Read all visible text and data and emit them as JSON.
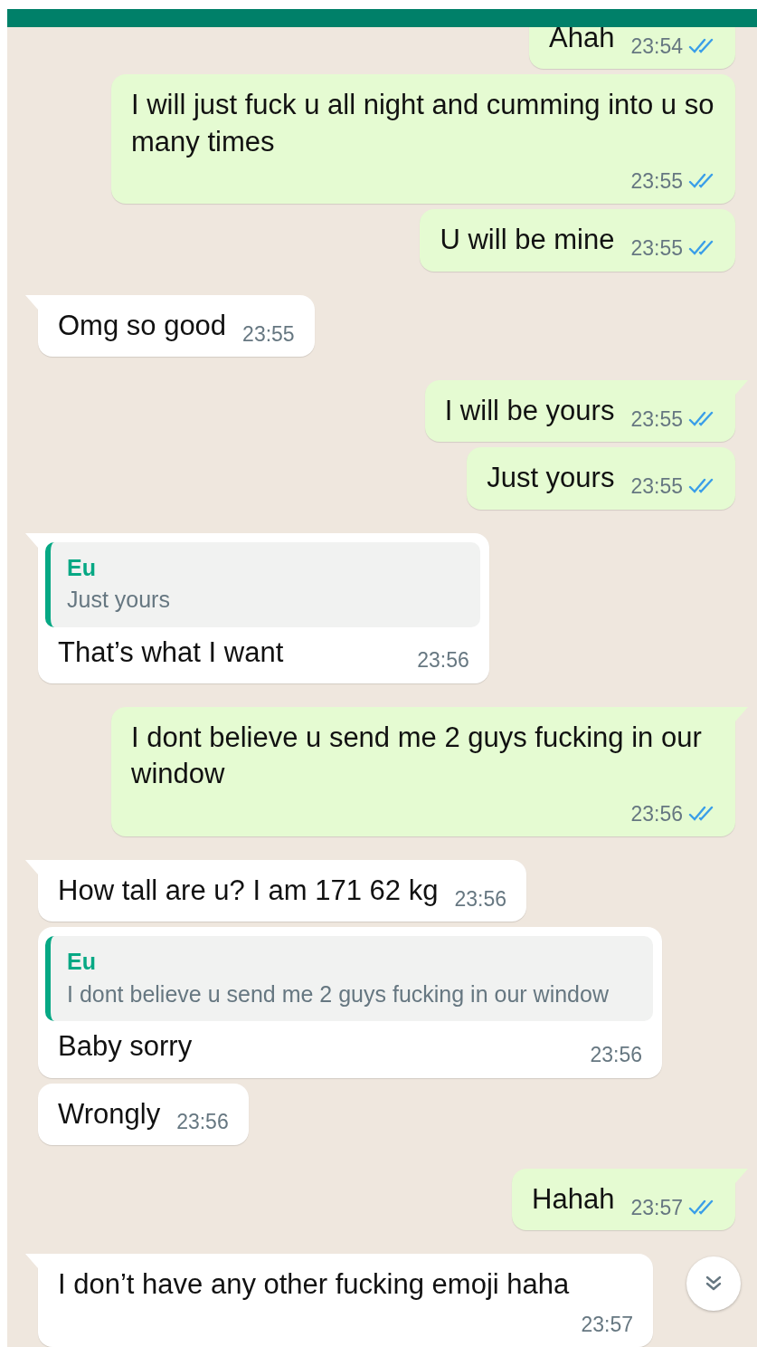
{
  "messages": [
    {
      "kind": "outgoing",
      "tail": false,
      "text": "Ahah",
      "time": "23:54",
      "read": true
    },
    {
      "kind": "outgoing",
      "tail": false,
      "text": "I will just fuck u all night and cumming into u so many times",
      "time": "23:55",
      "read": true
    },
    {
      "kind": "outgoing",
      "tail": false,
      "text": "U will be mine",
      "time": "23:55",
      "read": true
    },
    {
      "kind": "incoming",
      "tail": true,
      "text": "Omg so good",
      "time": "23:55"
    },
    {
      "kind": "outgoing",
      "tail": true,
      "text": "I will be yours",
      "time": "23:55",
      "read": true
    },
    {
      "kind": "outgoing",
      "tail": false,
      "text": "Just yours",
      "time": "23:55",
      "read": true
    },
    {
      "kind": "incoming",
      "tail": true,
      "quote": {
        "author": "Eu",
        "text": "Just yours"
      },
      "text": "That’s what I want",
      "time": "23:56"
    },
    {
      "kind": "outgoing",
      "tail": true,
      "text": "I dont believe u send me 2 guys fucking in our window",
      "time": "23:56",
      "read": true
    },
    {
      "kind": "incoming",
      "tail": true,
      "text": "How tall are u? I am 171 62 kg",
      "time": "23:56"
    },
    {
      "kind": "incoming",
      "tail": false,
      "quote": {
        "author": "Eu",
        "text": "I dont believe u send me 2 guys fucking in our window"
      },
      "text": "Baby sorry",
      "time": "23:56"
    },
    {
      "kind": "incoming",
      "tail": false,
      "text": "Wrongly",
      "time": "23:56"
    },
    {
      "kind": "outgoing",
      "tail": true,
      "text": "Hahah",
      "time": "23:57",
      "read": true
    },
    {
      "kind": "incoming",
      "tail": true,
      "text": "I don’t have any other fucking emoji haha",
      "time": "23:57"
    }
  ]
}
